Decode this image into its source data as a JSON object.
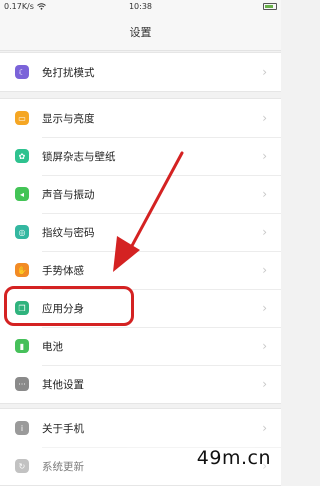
{
  "status_bar": {
    "signal_text": "0.17K/s",
    "time": "10:38",
    "icons": [
      "wifi-icon",
      "battery-icon"
    ]
  },
  "header": {
    "title": "设置"
  },
  "groups": [
    {
      "items": [
        {
          "label": "免打扰模式",
          "icon": "moon-icon",
          "color": "#7b63d9"
        }
      ]
    },
    {
      "items": [
        {
          "label": "显示与亮度",
          "icon": "display-icon",
          "color": "#f5a623"
        },
        {
          "label": "锁屏杂志与壁纸",
          "icon": "wallpaper-icon",
          "color": "#2ec28f"
        },
        {
          "label": "声音与振动",
          "icon": "speaker-icon",
          "color": "#43c456"
        },
        {
          "label": "指纹与密码",
          "icon": "fingerprint-icon",
          "color": "#34b7a0"
        },
        {
          "label": "手势体感",
          "icon": "hand-gesture-icon",
          "color": "#f28b25"
        },
        {
          "label": "应用分身",
          "icon": "app-clone-icon",
          "color": "#2fb37d"
        },
        {
          "label": "电池",
          "icon": "battery-settings-icon",
          "color": "#46c05a"
        },
        {
          "label": "其他设置",
          "icon": "more-icon",
          "color": "#8a8a8a"
        }
      ]
    },
    {
      "items": [
        {
          "label": "关于手机",
          "icon": "info-icon",
          "color": "#9a9a9a"
        },
        {
          "label": "系统更新",
          "icon": "update-icon",
          "color": "#9a9a9a"
        }
      ]
    }
  ],
  "annotation": {
    "highlighted_item": "应用分身",
    "color": "#d42222"
  },
  "watermark": "49m.cn"
}
